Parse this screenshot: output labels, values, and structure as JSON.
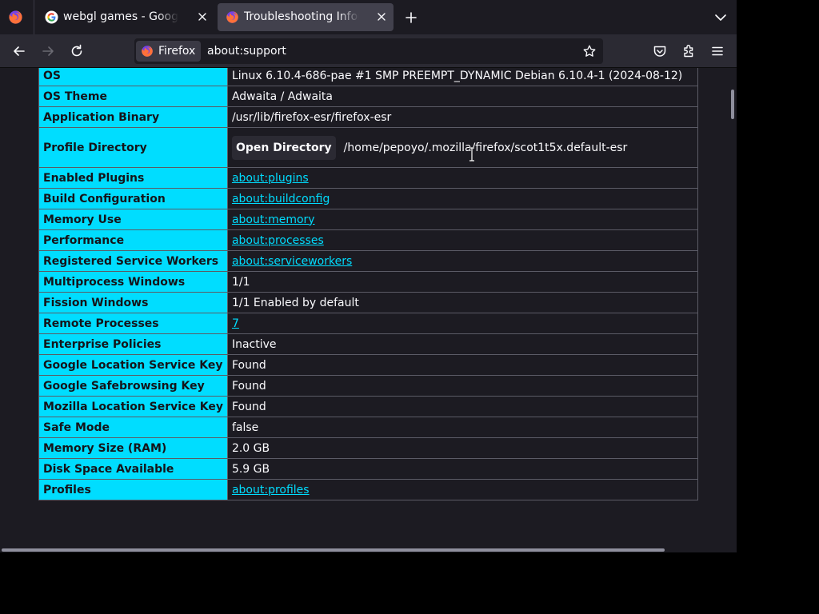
{
  "tabs": [
    {
      "title": "webgl games - Google Search",
      "favicon": "google-g-icon",
      "active": false
    },
    {
      "title": "Troubleshooting Information",
      "favicon": "firefox-icon",
      "active": true
    }
  ],
  "urlbar": {
    "identity_label": "Firefox",
    "url": "about:support"
  },
  "table": {
    "rows": [
      {
        "label": "OS",
        "value": "Linux 6.10.4-686-pae #1 SMP PREEMPT_DYNAMIC Debian 6.10.4-1 (2024-08-12)"
      },
      {
        "label": "OS Theme",
        "value": "Adwaita / Adwaita"
      },
      {
        "label": "Application Binary",
        "value": "/usr/lib/firefox-esr/firefox-esr"
      },
      {
        "label": "Profile Directory",
        "button": "Open Directory",
        "value": "/home/pepoyo/.mozilla/firefox/scot1t5x.default-esr"
      },
      {
        "label": "Enabled Plugins",
        "value": "about:plugins"
      },
      {
        "label": "Build Configuration",
        "value": "about:buildconfig"
      },
      {
        "label": "Memory Use",
        "value": "about:memory"
      },
      {
        "label": "Performance",
        "value": "about:processes"
      },
      {
        "label": "Registered Service Workers",
        "value": "about:serviceworkers"
      },
      {
        "label": "Multiprocess Windows",
        "value": "1/1"
      },
      {
        "label": "Fission Windows",
        "value": "1/1 Enabled by default"
      },
      {
        "label": "Remote Processes",
        "value": "7"
      },
      {
        "label": "Enterprise Policies",
        "value": "Inactive"
      },
      {
        "label": "Google Location Service Key",
        "value": "Found"
      },
      {
        "label": "Google Safebrowsing Key",
        "value": "Found"
      },
      {
        "label": "Mozilla Location Service Key",
        "value": "Found"
      },
      {
        "label": "Safe Mode",
        "value": "false"
      },
      {
        "label": "Memory Size (RAM)",
        "value": "2.0 GB"
      },
      {
        "label": "Disk Space Available",
        "value": "5.9 GB"
      },
      {
        "label": "Profiles",
        "value": "about:profiles"
      }
    ]
  },
  "colors": {
    "header_cell": "#00ddff",
    "link": "#00ddff",
    "background": "#1c1b22",
    "toolbar": "#2b2a33"
  }
}
